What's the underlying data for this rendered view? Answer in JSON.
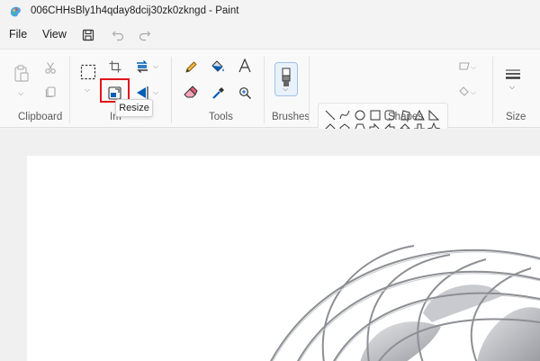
{
  "window": {
    "title": "006CHHsBly1h4qday8dcij30zk0zkngd - Paint"
  },
  "menu": {
    "file": "File",
    "view": "View"
  },
  "groups": {
    "clipboard": "Clipboard",
    "image": "Im",
    "tools": "Tools",
    "brushes": "Brushes",
    "shapes": "Shapes",
    "size": "Size"
  },
  "tooltip": {
    "resize": "Resize"
  },
  "icons": {
    "app": "paint-app-icon",
    "save": "save-icon",
    "undo": "undo-icon",
    "redo": "redo-icon",
    "paste": "paste-icon",
    "cut": "cut-icon",
    "copy": "copy-icon",
    "select": "select-icon",
    "crop": "crop-icon",
    "rotate": "rotate-icon",
    "resize": "resize-icon",
    "flip": "flip-icon",
    "pencil": "pencil-icon",
    "fill": "fill-icon",
    "text": "text-icon",
    "eraser": "eraser-icon",
    "picker": "color-picker-icon",
    "magnifier": "magnifier-icon",
    "brush": "brush-icon",
    "outline": "outline-icon",
    "shape-fill": "shape-fill-icon",
    "size": "size-icon"
  },
  "colors": {
    "highlight": "#e0161b",
    "accent": "#005fb8"
  }
}
